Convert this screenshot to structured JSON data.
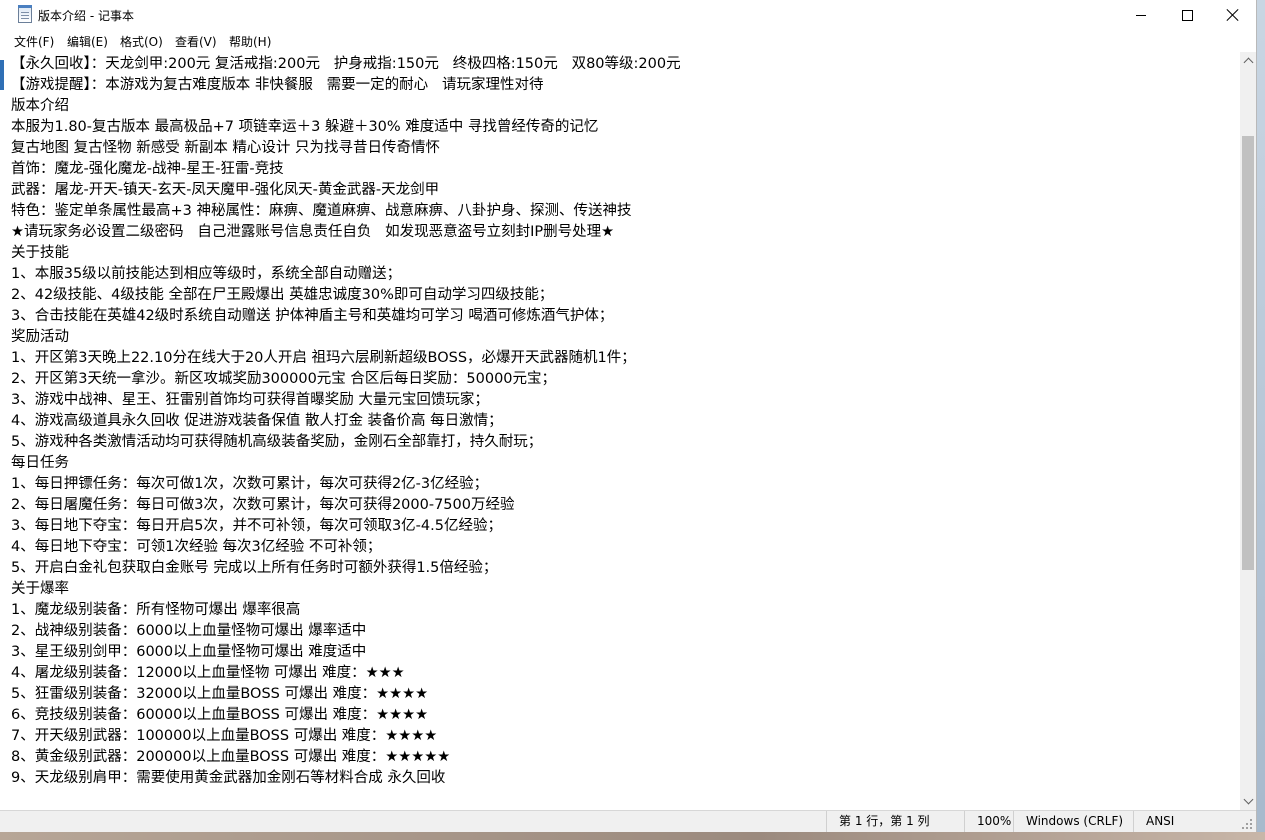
{
  "window": {
    "title": "版本介绍 - 记事本"
  },
  "menu": {
    "items": [
      {
        "label": "文件(F)"
      },
      {
        "label": "编辑(E)"
      },
      {
        "label": "格式(O)"
      },
      {
        "label": "查看(V)"
      },
      {
        "label": "帮助(H)"
      }
    ]
  },
  "document": {
    "lines": [
      "【永久回收】：天龙剑甲:200元 复活戒指:200元   护身戒指:150元   终极四格:150元   双80等级:200元",
      "【游戏提醒】：本游戏为复古难度版本 非快餐服   需要一定的耐心   请玩家理性对待",
      "版本介绍",
      "本服为1.80-复古版本 最高极品+7 项链幸运＋3 躲避＋30% 难度适中 寻找曾经传奇的记忆",
      "复古地图 复古怪物 新感受 新副本 精心设计 只为找寻昔日传奇情怀",
      "首饰：魔龙-强化魔龙-战神-星王-狂雷-竞技",
      "武器：屠龙-开天-镇天-玄天-凤天魔甲-强化凤天-黄金武器-天龙剑甲",
      "特色：鉴定单条属性最高+3 神秘属性：麻痹、魔道麻痹、战意麻痹、八卦护身、探测、传送神技",
      "★请玩家务必设置二级密码   自己泄露账号信息责任自负   如发现恶意盗号立刻封IP删号处理★",
      "关于技能",
      "1、本服35级以前技能达到相应等级时，系统全部自动赠送；",
      "2、42级技能、4级技能 全部在尸王殿爆出 英雄忠诚度30%即可自动学习四级技能；",
      "3、合击技能在英雄42级时系统自动赠送 护体神盾主号和英雄均可学习 喝酒可修炼酒气护体；",
      "奖励活动",
      "1、开区第3天晚上22.10分在线大于20人开启 祖玛六层刷新超级BOSS，必爆开天武器随机1件；",
      "2、开区第3天统一拿沙。新区攻城奖励300000元宝 合区后每日奖励：50000元宝；",
      "3、游戏中战神、星王、狂雷别首饰均可获得首曝奖励 大量元宝回馈玩家；",
      "4、游戏高级道具永久回收 促进游戏装备保值 散人打金 装备价高 每日激情；",
      "5、游戏种各类激情活动均可获得随机高级装备奖励，金刚石全部靠打，持久耐玩；",
      "每日任务",
      "1、每日押镖任务：每次可做1次，次数可累计，每次可获得2亿-3亿经验；",
      "2、每日屠魔任务：每日可做3次，次数可累计，每次可获得2000-7500万经验",
      "3、每日地下夺宝：每日开启5次，并不可补领，每次可领取3亿-4.5亿经验；",
      "4、每日地下夺宝：可领1次经验 每次3亿经验 不可补领；",
      "5、开启白金礼包获取白金账号 完成以上所有任务时可额外获得1.5倍经验；",
      "关于爆率",
      "1、魔龙级别装备：所有怪物可爆出 爆率很高",
      "2、战神级别装备：6000以上血量怪物可爆出 爆率适中",
      "3、星王级别剑甲：6000以上血量怪物可爆出 难度适中",
      "4、屠龙级别装备：12000以上血量怪物 可爆出 难度：★★★",
      "5、狂雷级别装备：32000以上血量BOSS 可爆出 难度：★★★★",
      "6、竞技级别装备：60000以上血量BOSS 可爆出 难度：★★★★",
      "7、开天级别武器：100000以上血量BOSS 可爆出 难度：★★★★",
      "8、黄金级别武器：200000以上血量BOSS 可爆出 难度：★★★★★",
      "9、天龙级别肩甲：需要使用黄金武器加金刚石等材料合成 永久回收"
    ]
  },
  "scrollbar": {
    "position_fraction": 0.23,
    "visible_fraction": 0.6
  },
  "status": {
    "position": "第 1 行，第 1 列",
    "zoom": "100%",
    "line_ending": "Windows (CRLF)",
    "encoding": "ANSI"
  },
  "icons": {
    "app": "notepad-icon",
    "minimize": "minimize-icon",
    "maximize": "maximize-icon",
    "close": "close-icon"
  }
}
